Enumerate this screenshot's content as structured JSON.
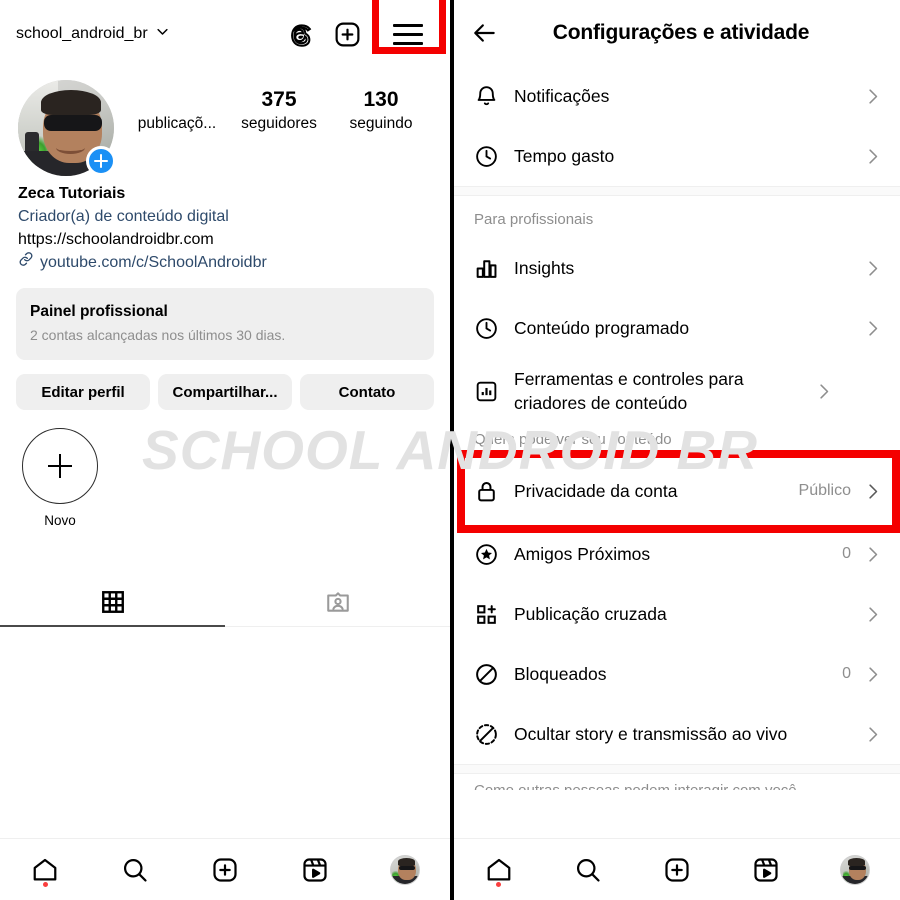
{
  "watermark": "SCHOOL ANDROID BR",
  "profile": {
    "username": "school_android_br",
    "header_icons": {
      "threads": "threads-icon",
      "add": "plus-square-icon",
      "menu": "hamburger-menu-icon"
    },
    "stats": [
      {
        "number": "",
        "label": "publicaçõ..."
      },
      {
        "number": "375",
        "label": "seguidores"
      },
      {
        "number": "130",
        "label": "seguindo"
      }
    ],
    "bio": {
      "name": "Zeca Tutoriais",
      "category": "Criador(a) de conteúdo digital",
      "website": "https://schoolandroidbr.com",
      "link": "youtube.com/c/SchoolAndroidbr"
    },
    "pro_card": {
      "title": "Painel profissional",
      "subtitle": "2 contas alcançadas nos últimos 30 dias."
    },
    "actions": [
      "Editar perfil",
      "Compartilhar...",
      "Contato"
    ],
    "highlight": {
      "label": "Novo"
    },
    "tabs": [
      {
        "name": "grid-tab",
        "active": true
      },
      {
        "name": "tagged-tab",
        "active": false
      }
    ]
  },
  "settings": {
    "title": "Configurações e atividade",
    "back": "back-arrow-icon",
    "groups": [
      {
        "header": null,
        "items": [
          {
            "icon": "bell-icon",
            "label": "Notificações",
            "value": ""
          },
          {
            "icon": "clock-icon",
            "label": "Tempo gasto",
            "value": ""
          }
        ]
      },
      {
        "header": "Para profissionais",
        "items": [
          {
            "icon": "bar-chart-icon",
            "label": "Insights",
            "value": ""
          },
          {
            "icon": "clock-icon",
            "label": "Conteúdo programado",
            "value": ""
          },
          {
            "icon": "chart-box-icon",
            "label": "Ferramentas e controles para criadores de conteúdo",
            "value": ""
          }
        ]
      },
      {
        "header": "Quem pode ver seu conteúdo",
        "items": [
          {
            "icon": "lock-icon",
            "label": "Privacidade da conta",
            "value": "Público",
            "highlighted": true
          },
          {
            "icon": "star-circle-icon",
            "label": "Amigos Próximos",
            "value": "0"
          },
          {
            "icon": "crosspost-icon",
            "label": "Publicação cruzada",
            "value": ""
          },
          {
            "icon": "block-icon",
            "label": "Bloqueados",
            "value": "0"
          },
          {
            "icon": "hide-story-icon",
            "label": "Ocultar story e transmissão ao vivo",
            "value": ""
          }
        ]
      }
    ],
    "clipped_header": "Como outras pessoas podem interagir com você"
  },
  "bottom_nav": [
    {
      "icon": "home-icon",
      "badge": true
    },
    {
      "icon": "search-icon",
      "badge": false
    },
    {
      "icon": "add-post-icon",
      "badge": false
    },
    {
      "icon": "reels-icon",
      "badge": false
    },
    {
      "icon": "profile-avatar-icon",
      "badge": false
    }
  ],
  "colors": {
    "highlight_red": "#f40000",
    "link_blue": "#2e4a6b",
    "badge_blue": "#1b90f5",
    "muted": "#8e8e8e"
  }
}
